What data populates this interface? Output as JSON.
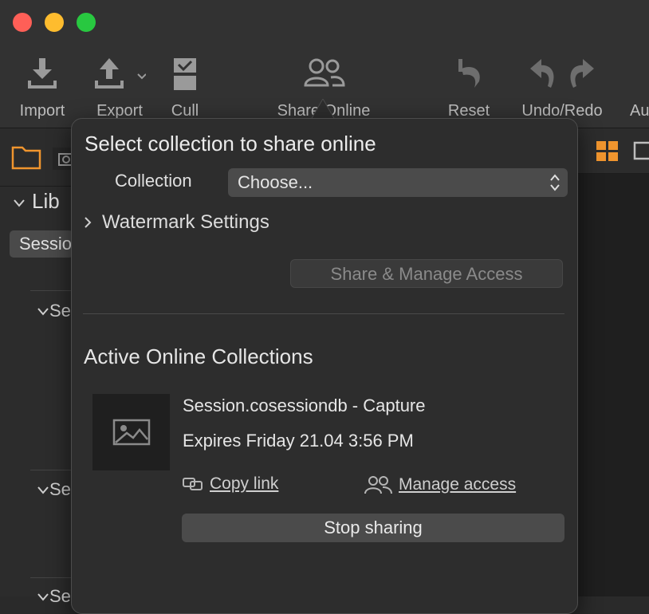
{
  "toolbar": {
    "items": [
      {
        "label": "Import",
        "icon": "import-icon"
      },
      {
        "label": "Export",
        "icon": "export-icon"
      },
      {
        "label": "Cull",
        "icon": "cull-icon"
      },
      {
        "label": "Share Online",
        "icon": "share-online-icon"
      },
      {
        "label": "Reset",
        "icon": "reset-icon"
      },
      {
        "label": "Undo/Redo",
        "icon": "undo-redo-icon"
      },
      {
        "label": "Au",
        "icon": ""
      }
    ]
  },
  "sidebar": {
    "library_label": "Lib",
    "session_pill": "Sessio",
    "sections": [
      "Se",
      "Se",
      "Se"
    ]
  },
  "popover": {
    "title": "Select collection to share online",
    "collection_label": "Collection",
    "collection_value": "Choose...",
    "watermark_label": "Watermark Settings",
    "share_button": "Share & Manage Access",
    "active_title": "Active Online Collections",
    "collection_item": {
      "name": "Session.cosessiondb - Capture",
      "expires": "Expires Friday  21.04  3:56 PM",
      "copy_link": "Copy link",
      "manage_access": "Manage access",
      "stop_button": "Stop sharing"
    }
  },
  "colors": {
    "accent": "#f0952e",
    "window_bg": "#2a2a2a"
  }
}
